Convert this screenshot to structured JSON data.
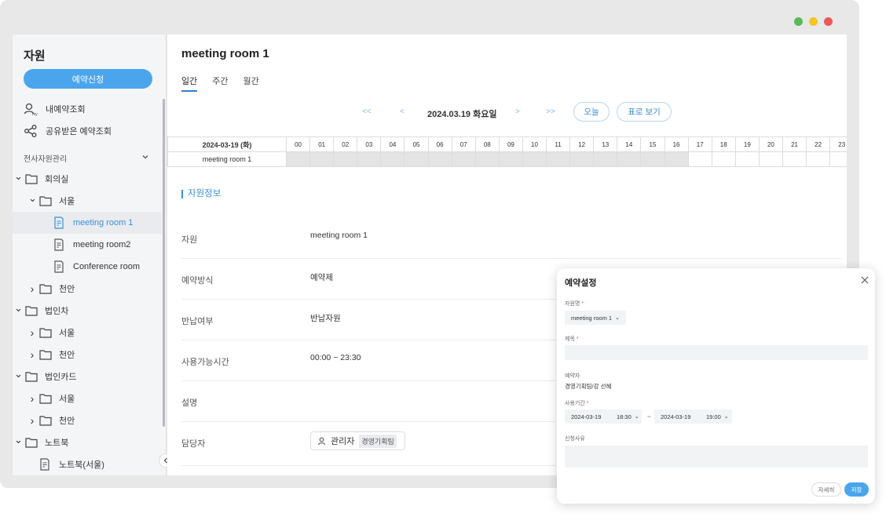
{
  "window": {
    "traffic_colors": [
      "#5cb85c",
      "#f3c623",
      "#ec5858"
    ]
  },
  "sidebar": {
    "title": "자원",
    "reserve_button": "예약신청",
    "links": [
      {
        "label": "내예약조회",
        "icon": "my-user-icon"
      },
      {
        "label": "공유받은 예약조회",
        "icon": "share-icon"
      }
    ],
    "section_label": "전사자원관리",
    "tree": [
      {
        "label": "회의실",
        "type": "folder",
        "depth": 0,
        "expanded": true
      },
      {
        "label": "서울",
        "type": "folder",
        "depth": 1,
        "expanded": true
      },
      {
        "label": "meeting room 1",
        "type": "resource",
        "depth": 2,
        "active": true
      },
      {
        "label": "meeting room2",
        "type": "resource",
        "depth": 2
      },
      {
        "label": "Conference room",
        "type": "resource",
        "depth": 2
      },
      {
        "label": "천안",
        "type": "folder",
        "depth": 1,
        "expanded": false
      },
      {
        "label": "법인차",
        "type": "folder",
        "depth": 0,
        "expanded": true
      },
      {
        "label": "서울",
        "type": "folder",
        "depth": 1,
        "expanded": false
      },
      {
        "label": "천안",
        "type": "folder",
        "depth": 1,
        "expanded": false
      },
      {
        "label": "법인카드",
        "type": "folder",
        "depth": 0,
        "expanded": true
      },
      {
        "label": "서울",
        "type": "folder",
        "depth": 1,
        "expanded": false
      },
      {
        "label": "천안",
        "type": "folder",
        "depth": 1,
        "expanded": false
      },
      {
        "label": "노트북",
        "type": "folder",
        "depth": 0,
        "expanded": true
      },
      {
        "label": "노트북(서울)",
        "type": "resource",
        "depth": 1
      }
    ]
  },
  "main": {
    "title": "meeting room 1",
    "tabs": [
      {
        "label": "일간",
        "active": true
      },
      {
        "label": "주간",
        "active": false
      },
      {
        "label": "월간",
        "active": false
      }
    ],
    "date_nav": {
      "first": "<<",
      "prev": "<",
      "current": "2024.03.19 화요일",
      "next": ">",
      "last": ">>",
      "today_button": "오늘",
      "table_view_button": "표로 보기"
    },
    "schedule": {
      "date_header": "2024-03-19 (화)",
      "hours": [
        "00",
        "01",
        "02",
        "03",
        "04",
        "05",
        "06",
        "07",
        "08",
        "09",
        "10",
        "11",
        "12",
        "13",
        "14",
        "15",
        "16",
        "17",
        "18",
        "19",
        "20",
        "21",
        "22",
        "23"
      ],
      "row_label": "meeting room 1",
      "booked_until_hour": 17
    },
    "info_title": "자원정보",
    "info": [
      {
        "key": "자원",
        "value": "meeting room 1"
      },
      {
        "key": "예약방식",
        "value": "예약제"
      },
      {
        "key": "반납여부",
        "value": "반납자원"
      },
      {
        "key": "사용가능시간",
        "value": "00:00 ~ 23:30"
      },
      {
        "key": "설명",
        "value": ""
      },
      {
        "key": "담당자",
        "value": ""
      }
    ],
    "manager": {
      "name": "관리자",
      "team": "경영기획팀"
    }
  },
  "dialog": {
    "title": "예약설정",
    "resource_label": "자원명",
    "resource_value": "meeting room 1",
    "subject_label": "제목",
    "booker_label": "예약자",
    "booker_value": "경영기획팀/강 선혜",
    "period_label": "사용기간",
    "start_date": "2024-03-19",
    "start_time": "18:30",
    "tilde": "~",
    "end_date": "2024-03-19",
    "end_time": "19:00",
    "reason_label": "신청사유",
    "detail_button": "자세히",
    "save_button": "저장"
  }
}
